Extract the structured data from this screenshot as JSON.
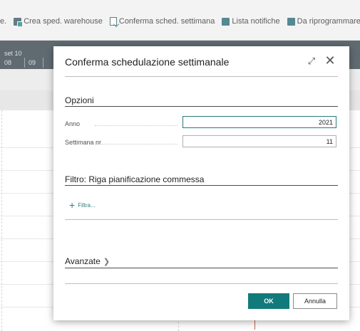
{
  "toolbar": {
    "items": [
      {
        "label": "e.",
        "icon": "none"
      },
      {
        "label": "Crea sped. warehouse",
        "icon": "create-warehouse-shipment-icon"
      },
      {
        "label": "Conferma sched. settimana",
        "icon": "confirm-schedule-icon"
      },
      {
        "label": "Lista notifiche",
        "icon": "notification-list-icon"
      },
      {
        "label": "Da riprogrammare",
        "icon": "reschedule-icon"
      }
    ]
  },
  "background": {
    "week_label": "set 10",
    "day_1": "08",
    "day_2": "09"
  },
  "dialog": {
    "title": "Conferma schedulazione settimanale",
    "options_section": "Opzioni",
    "fields": [
      {
        "label": "Anno",
        "value": "2021"
      },
      {
        "label": "Settimana nr.",
        "value": "11"
      }
    ],
    "filter_section": "Filtro: Riga pianificazione commessa",
    "filter_link": "Filtra...",
    "advanced_section": "Avanzate",
    "ok_label": "OK",
    "cancel_label": "Annulla"
  },
  "colors": {
    "accent": "#127a7a",
    "header_bg": "#3d4a52"
  }
}
